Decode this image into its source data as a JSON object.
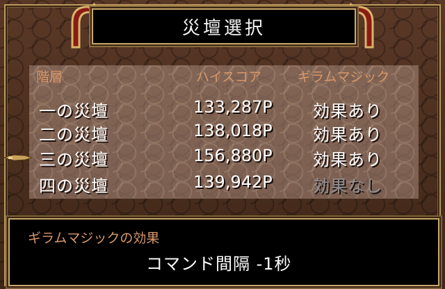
{
  "title": "災壇選択",
  "table": {
    "headers": {
      "floor": "階層",
      "high_score": "ハイスコア",
      "magic": "ギラムマジック"
    },
    "rows": [
      {
        "name": "一の災壇",
        "score": "133,287P",
        "effect": "効果あり",
        "active": true
      },
      {
        "name": "二の災壇",
        "score": "138,018P",
        "effect": "効果あり",
        "active": true
      },
      {
        "name": "三の災壇",
        "score": "156,880P",
        "effect": "効果あり",
        "active": true
      },
      {
        "name": "四の災壇",
        "score": "139,942P",
        "effect": "効果なし",
        "active": false
      }
    ],
    "selected_index": 2
  },
  "description": {
    "title": "ギラムマジックの効果",
    "value": "コマンド間隔 -1秒"
  },
  "colors": {
    "header_text": "#d8986a",
    "active_text": "#ffffff",
    "inactive_text": "#8f8f93",
    "frame_gold": "#c9a96a"
  },
  "icons": {
    "cursor": "pointing-hand-cursor-icon",
    "ornament": "dragon-ornament-icon"
  }
}
